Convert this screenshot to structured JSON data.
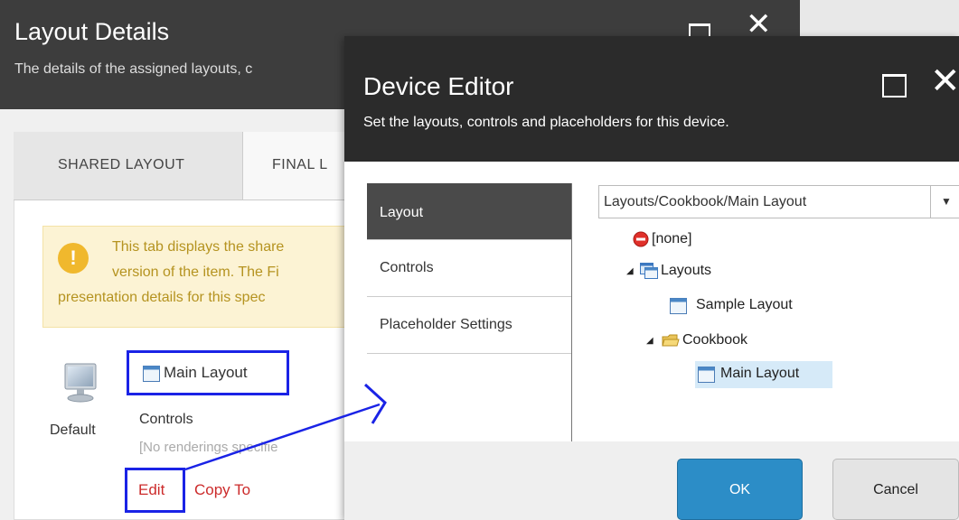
{
  "back_dialog": {
    "title": "Layout Details",
    "subtitle": "The details of the assigned layouts, c",
    "tabs": [
      {
        "label": "SHARED LAYOUT"
      },
      {
        "label": "FINAL L"
      }
    ],
    "info_icon": "!",
    "info_lines": [
      "This tab displays the share",
      "version of the item. The Fi",
      "presentation details for this spec"
    ],
    "device": {
      "label": "Default",
      "icon": "monitor-icon"
    },
    "layout_link": "Main Layout",
    "controls_label": "Controls",
    "controls_placeholder": "[No renderings specifie",
    "edit_link": "Edit",
    "copy_to_link": "Copy To"
  },
  "device_editor": {
    "title": "Device Editor",
    "subtitle": "Set the layouts, controls and placeholders for this device.",
    "nav": [
      {
        "label": "Layout",
        "active": true
      },
      {
        "label": "Controls"
      },
      {
        "label": "Placeholder Settings"
      }
    ],
    "layout_select": {
      "value": "Layouts/Cookbook/Main Layout",
      "button_glyph": "▼"
    },
    "tree": {
      "none": "[none]",
      "layouts": "Layouts",
      "sample_layout": "Sample Layout",
      "cookbook": "Cookbook",
      "main_layout": "Main Layout",
      "expanded_glyph": "◢"
    },
    "ok_label": "OK",
    "cancel_label": "Cancel"
  },
  "colors": {
    "annotation_blue": "#1a23e6",
    "primary_button": "#2c8dc7",
    "link_red": "#cc2b2b",
    "header_dark": "#2b2b2b"
  }
}
